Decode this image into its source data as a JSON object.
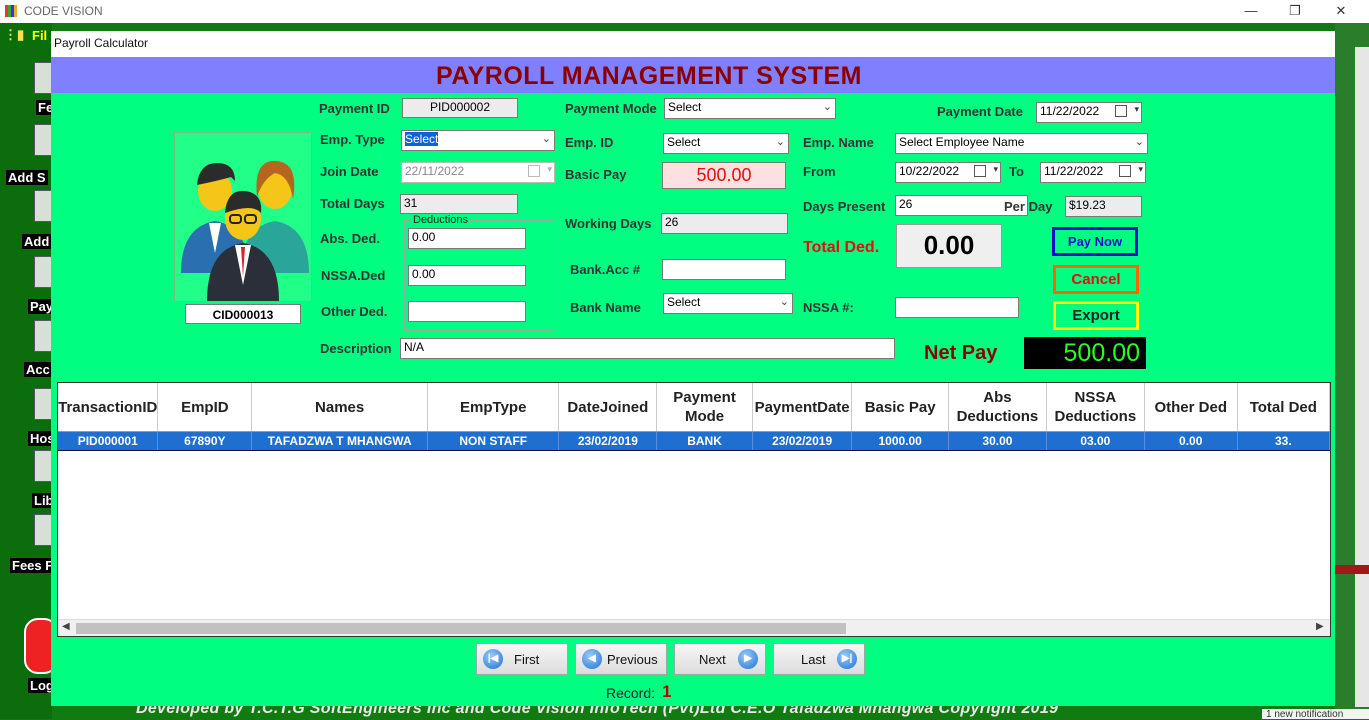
{
  "outer": {
    "title": "CODE VISION",
    "menu_first": "Fil",
    "side_labels": [
      "Fe",
      "Add S",
      "Add",
      "Pay",
      "Acc",
      "Hos",
      "Lib",
      "Fees F",
      "Log"
    ],
    "footer_credit": "Developed by T.C.T.G SoftEngineers Inc and Code Vision InfoTech (Pvt)Ltd C.E.O Tafadzwa Mhangwa Copyright 2019",
    "notification": "1 new notification"
  },
  "form": {
    "title": "Payroll Calculator",
    "header": "PAYROLL MANAGEMENT SYSTEM"
  },
  "fields": {
    "payment_id_label": "Payment ID",
    "payment_id": "PID000002",
    "payment_mode_label": "Payment Mode",
    "payment_mode": "Select",
    "payment_date_label": "Payment Date",
    "payment_date": "11/22/2022",
    "emp_type_label": "Emp. Type",
    "emp_type": "Select",
    "emp_id_label": "Emp. ID",
    "emp_id": "Select",
    "emp_name_label": "Emp. Name",
    "emp_name": "Select Employee Name",
    "join_date_label": "Join Date",
    "join_date": "22/11/2022",
    "basic_pay_label": "Basic Pay",
    "basic_pay": "500.00",
    "from_label": "From",
    "from_date": "10/22/2022",
    "to_label": "To",
    "to_date": "11/22/2022",
    "total_days_label": "Total Days",
    "total_days": "31",
    "working_days_label": "Working Days",
    "working_days": "26",
    "days_present_label": "Days Present",
    "days_present": "26",
    "per_day_label": "Per Day",
    "per_day": "$19.23",
    "deductions_title": "Deductions",
    "abs_ded_label": "Abs. Ded.",
    "abs_ded": "0.00",
    "nssa_ded_label": "NSSA.Ded",
    "nssa_ded": "0.00",
    "other_ded_label": "Other Ded.",
    "other_ded": "",
    "total_ded_label": "Total Ded.",
    "total_ded": "0.00",
    "bank_acc_label": "Bank.Acc #",
    "bank_acc": "",
    "bank_name_label": "Bank Name",
    "bank_name": "Select",
    "nssa_no_label": "NSSA #:",
    "nssa_no": "",
    "description_label": "Description",
    "description": "N/A",
    "net_pay_label": "Net Pay",
    "net_pay": "500.00",
    "photo_id": "CID000013"
  },
  "buttons": {
    "pay_now": "Pay Now",
    "cancel": "Cancel",
    "export": "Export",
    "first": "First",
    "previous": "Previous",
    "next": "Next",
    "last": "Last"
  },
  "colors": {
    "form_bg": "#00ff80",
    "header_band": "#8080ff",
    "header_text": "#8b0000",
    "pay_now_border": "#1010cc",
    "cancel_border": "#ff6600",
    "export_border": "#ffff00",
    "selected_row": "#1e6fcf"
  },
  "table": {
    "headers": [
      "TransactionID",
      "EmpID",
      "Names",
      "EmpType",
      "DateJoined",
      "Payment Mode",
      "PaymentDate",
      "Basic Pay",
      "Abs Deductions",
      "NSSA Deductions",
      "Other Ded",
      "Total Ded"
    ],
    "rows": [
      [
        "PID000001",
        "67890Y",
        "TAFADZWA T MHANGWA",
        "NON STAFF",
        "23/02/2019",
        "BANK",
        "23/02/2019",
        "1000.00",
        "30.00",
        "03.00",
        "0.00",
        "33."
      ]
    ]
  },
  "record": {
    "label": "Record:",
    "value": "1"
  }
}
